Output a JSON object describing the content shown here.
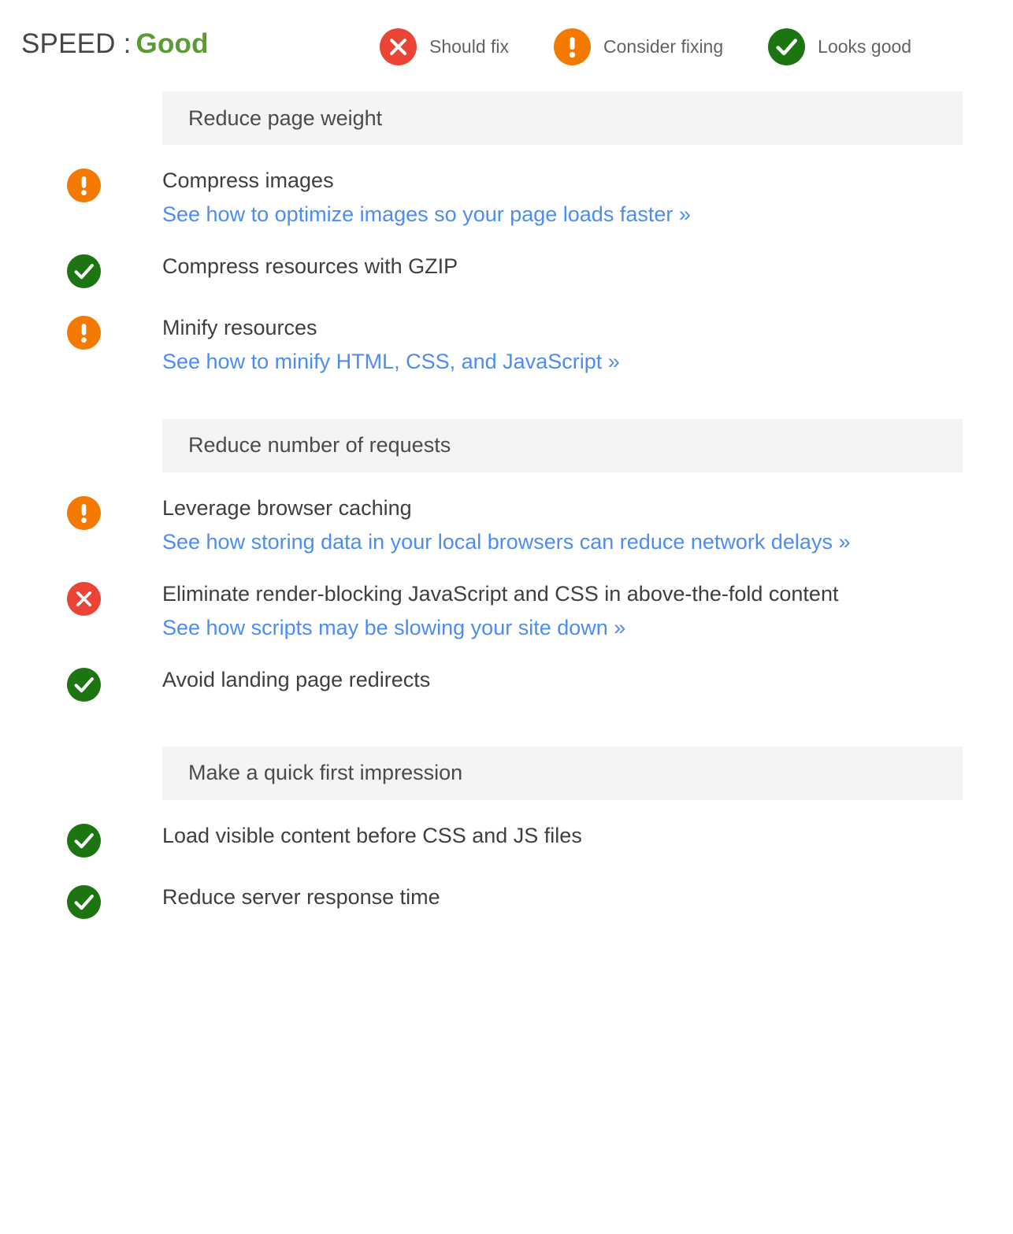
{
  "header": {
    "title_prefix": "SPEED :",
    "grade": "Good",
    "grade_color": "#5a9c33",
    "legend": [
      {
        "icon": "error-icon",
        "status": "fix",
        "label": "Should fix",
        "color": "#ea4436"
      },
      {
        "icon": "warning-icon",
        "status": "warn",
        "label": "Consider fixing",
        "color": "#f47900"
      },
      {
        "icon": "success-icon",
        "status": "good",
        "label": "Looks good",
        "color": "#1d7512"
      }
    ]
  },
  "link_color": "#4c8cf5",
  "sections": [
    {
      "title": "Reduce page weight",
      "items": [
        {
          "status": "warn",
          "icon": "warning-icon",
          "title": "Compress images",
          "link": "See how to optimize images so your page loads faster »"
        },
        {
          "status": "good",
          "icon": "success-icon",
          "title": "Compress resources with GZIP",
          "link": ""
        },
        {
          "status": "warn",
          "icon": "warning-icon",
          "title": "Minify resources",
          "link": "See how to minify HTML, CSS, and JavaScript »"
        }
      ]
    },
    {
      "title": "Reduce number of requests",
      "items": [
        {
          "status": "warn",
          "icon": "warning-icon",
          "title": "Leverage browser caching",
          "link": "See how storing data in your local browsers can reduce network delays »"
        },
        {
          "status": "fix",
          "icon": "error-icon",
          "title": "Eliminate render-blocking JavaScript and CSS in above-the-fold content",
          "link": "See how scripts may be slowing your site down »"
        },
        {
          "status": "good",
          "icon": "success-icon",
          "title": "Avoid landing page redirects",
          "link": ""
        }
      ]
    },
    {
      "title": "Make a quick first impression",
      "items": [
        {
          "status": "good",
          "icon": "success-icon",
          "title": "Load visible content before CSS and JS files",
          "link": ""
        },
        {
          "status": "good",
          "icon": "success-icon",
          "title": "Reduce server response time",
          "link": ""
        }
      ]
    }
  ]
}
